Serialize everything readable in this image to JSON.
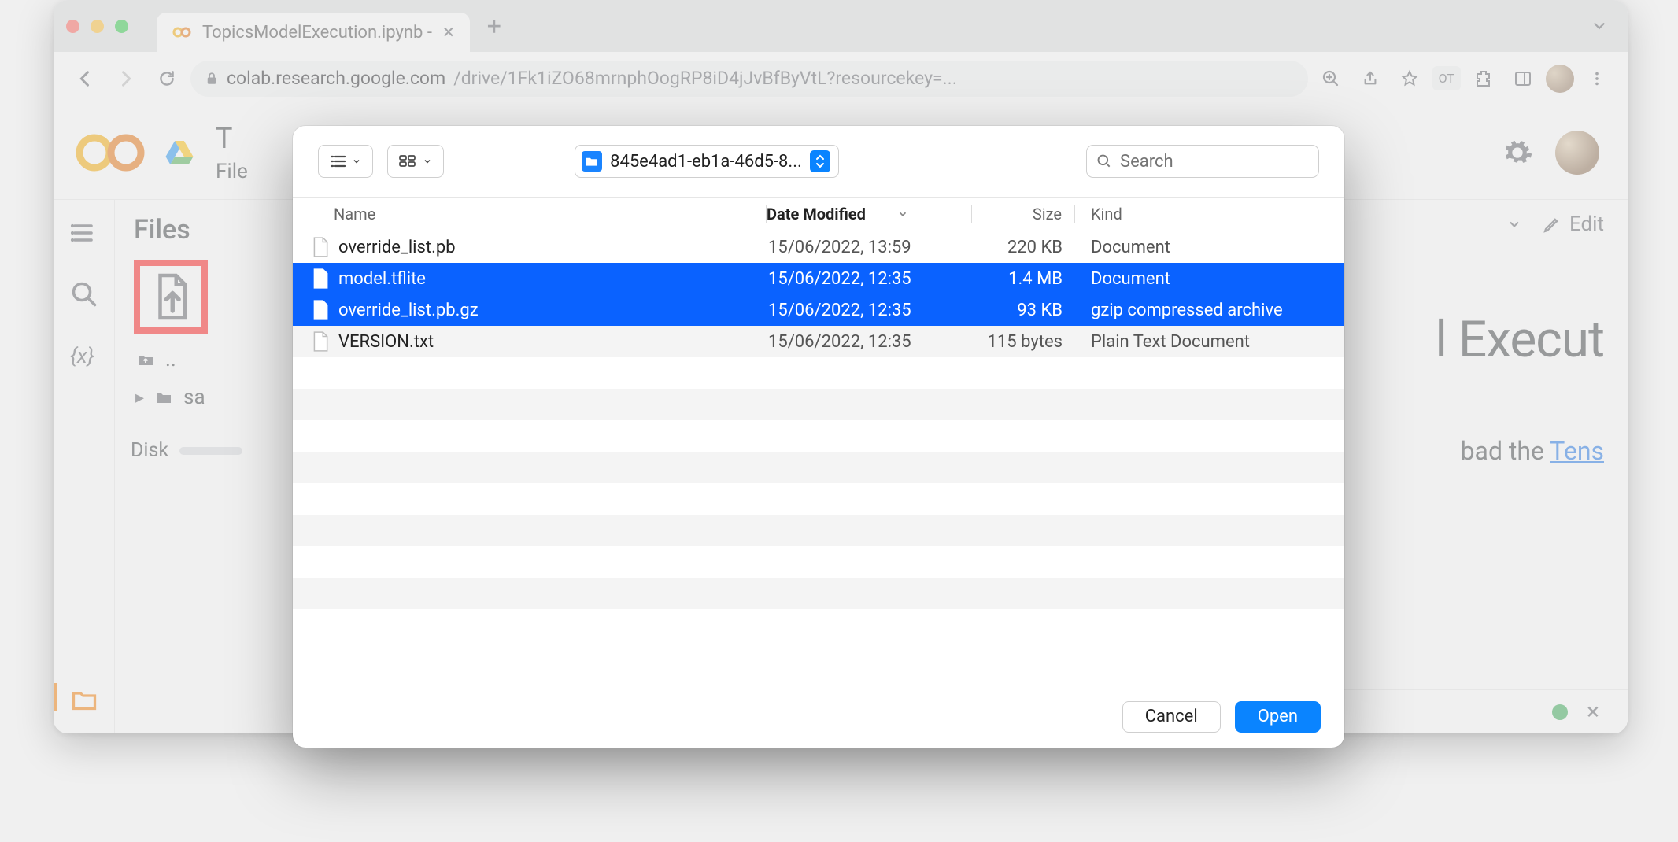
{
  "browser": {
    "tab_title": "TopicsModelExecution.ipynb -",
    "url_host": "colab.research.google.com",
    "url_path": "/drive/1Fk1iZO68mrnphOogRP8iD4jJvBfByVtL?resourcekey=...",
    "profile_badge": "OT"
  },
  "colab": {
    "drive_letter": "T",
    "menu_first": "File",
    "side_title": "Files",
    "tree_parent": "..",
    "tree_item": "sa",
    "disk_label": "Disk",
    "toolbar_edit": "Edit",
    "heading_fragment": "l Execut",
    "body_fragment_pre": "bad the ",
    "body_fragment_link": "Tens"
  },
  "dialog": {
    "folder_name": "845e4ad1-eb1a-46d5-8...",
    "search_placeholder": "Search",
    "columns": {
      "name": "Name",
      "date": "Date Modified",
      "size": "Size",
      "kind": "Kind"
    },
    "files": [
      {
        "name": "override_list.pb",
        "date": "15/06/2022, 13:59",
        "size": "220 KB",
        "kind": "Document",
        "selected": false,
        "alt": false
      },
      {
        "name": "model.tflite",
        "date": "15/06/2022, 12:35",
        "size": "1.4 MB",
        "kind": "Document",
        "selected": true,
        "alt": false
      },
      {
        "name": "override_list.pb.gz",
        "date": "15/06/2022, 12:35",
        "size": "93 KB",
        "kind": "gzip compressed archive",
        "selected": true,
        "alt": false
      },
      {
        "name": "VERSION.txt",
        "date": "15/06/2022, 12:35",
        "size": "115 bytes",
        "kind": "Plain Text Document",
        "selected": false,
        "alt": true
      }
    ],
    "cancel": "Cancel",
    "open": "Open"
  }
}
